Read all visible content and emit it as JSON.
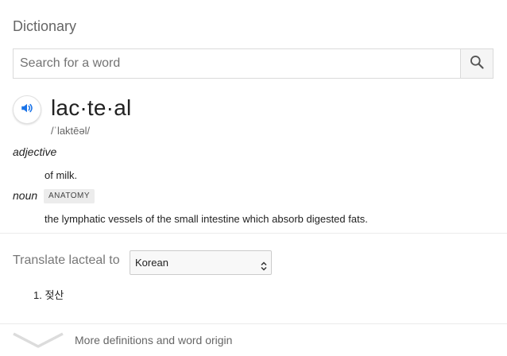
{
  "card": {
    "title": "Dictionary"
  },
  "search": {
    "placeholder": "Search for a word",
    "value": ""
  },
  "entry": {
    "headword": "lac·te·al",
    "phonetic": "/ˈlaktēəl/",
    "senses": [
      {
        "pos": "adjective",
        "label": "",
        "definition": "of milk."
      },
      {
        "pos": "noun",
        "label": "ANATOMY",
        "definition": "the lymphatic vessels of the small intestine which absorb digested fats."
      }
    ]
  },
  "translate": {
    "label": "Translate lacteal to",
    "selected_language": "Korean",
    "results": [
      "1. 젖산"
    ]
  },
  "more": {
    "label": "More definitions and word origin"
  },
  "colors": {
    "accent": "#1a73e8",
    "text": "#222222",
    "muted": "#666666"
  },
  "icons": [
    "speaker-icon",
    "search-icon",
    "chevron-down-icon",
    "select-arrows-icon"
  ]
}
